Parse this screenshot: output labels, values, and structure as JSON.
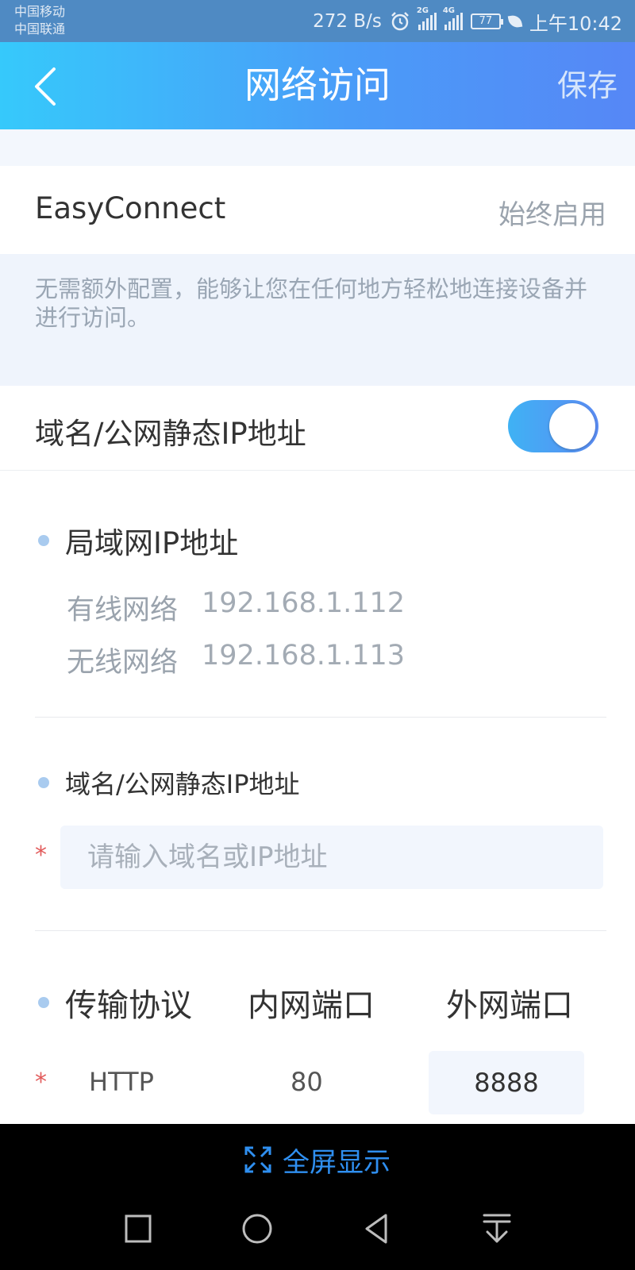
{
  "status_bar": {
    "carrier_1": "中国移动",
    "carrier_2": "中国联通",
    "net_speed": "272 B/s",
    "sim1_net": "2G",
    "sim2_net": "4G",
    "battery": "77",
    "time": "上午10:42"
  },
  "nav": {
    "title": "网络访问",
    "save_label": "保存"
  },
  "easyconnect": {
    "label": "EasyConnect",
    "value": "始终启用",
    "description": "无需额外配置，能够让您在任何地方轻松地连接设备并进行访问。"
  },
  "static_ip_toggle": {
    "label": "域名/公网静态IP地址",
    "enabled": true
  },
  "lan": {
    "heading": "局域网IP地址",
    "wired_label": "有线网络",
    "wired_ip": "192.168.1.112",
    "wifi_label": "无线网络",
    "wifi_ip": "192.168.1.113"
  },
  "domain": {
    "heading": "域名/公网静态IP地址",
    "required_mark": "*",
    "placeholder": "请输入域名或IP地址",
    "value": ""
  },
  "ports": {
    "heading": "传输协议",
    "inner_heading": "内网端口",
    "outer_heading": "外网端口",
    "rows": [
      {
        "required_mark": "*",
        "protocol": "HTTP",
        "inner": "80",
        "outer": "8888"
      }
    ]
  },
  "bottom": {
    "fullscreen_label": "全屏显示"
  },
  "colors": {
    "accent": "#4a9cf8",
    "nav_gradient_start": "#36c9fb",
    "nav_gradient_end": "#5687f6",
    "required": "#e25c5c",
    "fullscreen": "#2f8ff0"
  }
}
